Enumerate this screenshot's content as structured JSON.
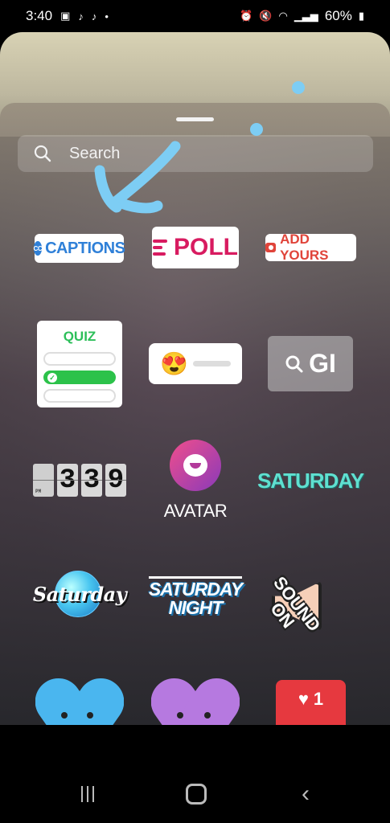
{
  "status_bar": {
    "time": "3:40",
    "battery": "60%",
    "icons": [
      "gallery-icon",
      "tiktok-icon",
      "tiktok-icon",
      "dot-icon",
      "alarm-icon",
      "mute-icon",
      "wifi-icon",
      "signal-icon",
      "battery-icon"
    ]
  },
  "search": {
    "placeholder": "Search"
  },
  "stickers": {
    "captions": {
      "label": "CAPTIONS",
      "badge": "CC"
    },
    "poll": {
      "label": "POLL"
    },
    "add_yours": {
      "label": "ADD YOURS"
    },
    "quiz": {
      "label": "QUIZ"
    },
    "emoji_slider": {
      "emoji": "😍"
    },
    "gif": {
      "label": "GI"
    },
    "clock": {
      "digits": [
        "",
        "3",
        "3",
        "9"
      ],
      "meridiem": "PM"
    },
    "avatar": {
      "label": "AVATAR"
    },
    "saturday_text": {
      "label": "SATURDAY"
    },
    "saturday_disco": {
      "label": "Saturday"
    },
    "saturday_night": {
      "line1": "SATURDAY",
      "line2": "NIGHT"
    },
    "sound_on": {
      "line1": "SOUND",
      "line2": "ON"
    },
    "like_count": {
      "count": "1"
    }
  },
  "colors": {
    "captions_blue": "#2f80d8",
    "poll_pink": "#d81b60",
    "add_yours_red": "#e0443a",
    "quiz_green": "#2cc24a",
    "saturday_teal": "#5fe0d0",
    "like_red": "#e6393f",
    "annotation_blue": "#7dcdf4"
  },
  "nav": {
    "items": [
      "recent-apps-icon",
      "home-icon",
      "back-icon"
    ]
  }
}
